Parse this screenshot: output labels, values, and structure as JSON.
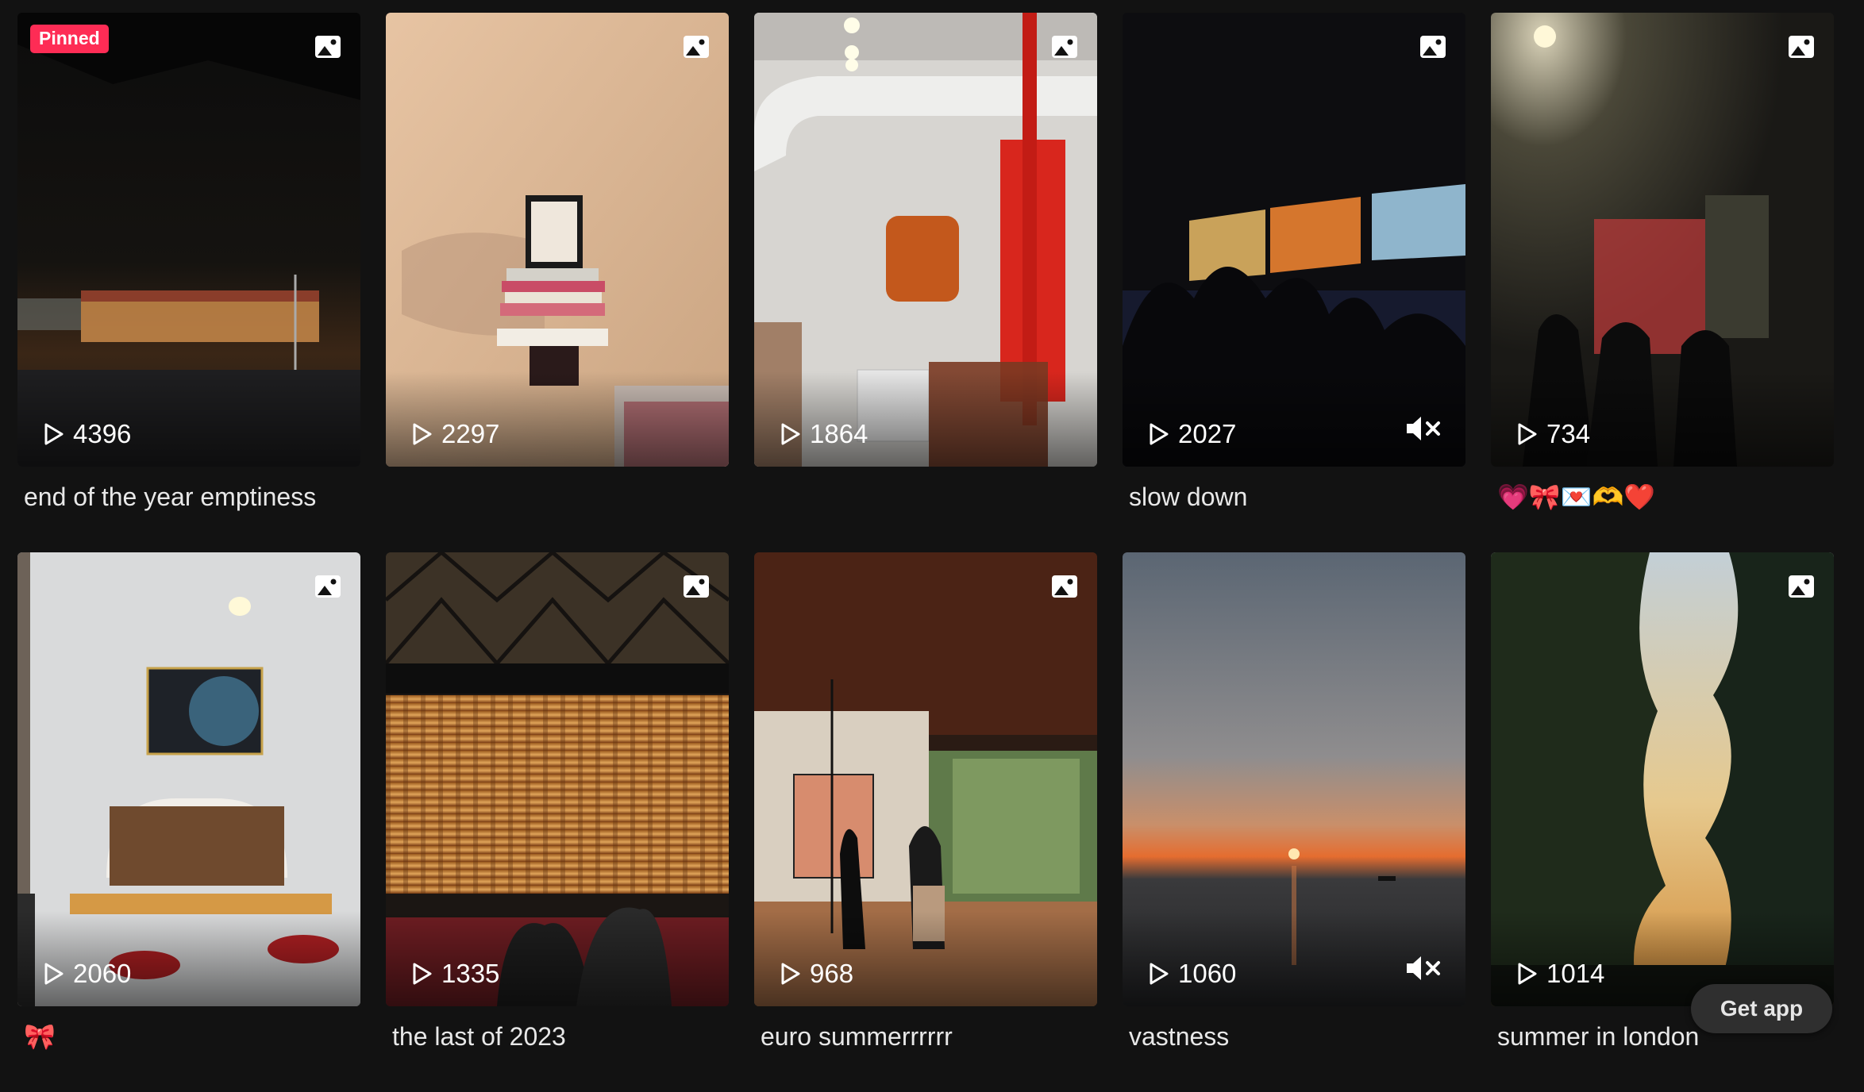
{
  "grid": {
    "items": [
      {
        "pinned_label": "Pinned",
        "views": "4396",
        "caption": "end of the year emptiness",
        "muted": false
      },
      {
        "views": "2297",
        "caption": "",
        "muted": false
      },
      {
        "views": "1864",
        "caption": "",
        "muted": false
      },
      {
        "views": "2027",
        "caption": "slow down",
        "muted": true
      },
      {
        "views": "734",
        "caption": "💗🎀💌🫶❤️",
        "muted": false
      },
      {
        "views": "2060",
        "caption": "🎀",
        "muted": false
      },
      {
        "views": "1335",
        "caption": "the last of 2023",
        "muted": false
      },
      {
        "views": "968",
        "caption": "euro summerrrrrr",
        "muted": false
      },
      {
        "views": "1060",
        "caption": "vastness",
        "muted": true
      },
      {
        "views": "1014",
        "caption": "summer in london",
        "muted": false
      }
    ]
  },
  "get_app": {
    "label": "Get app"
  },
  "icons": {
    "photo": "photo-mode-icon",
    "play": "play-icon",
    "mute": "muted-speaker-icon"
  }
}
